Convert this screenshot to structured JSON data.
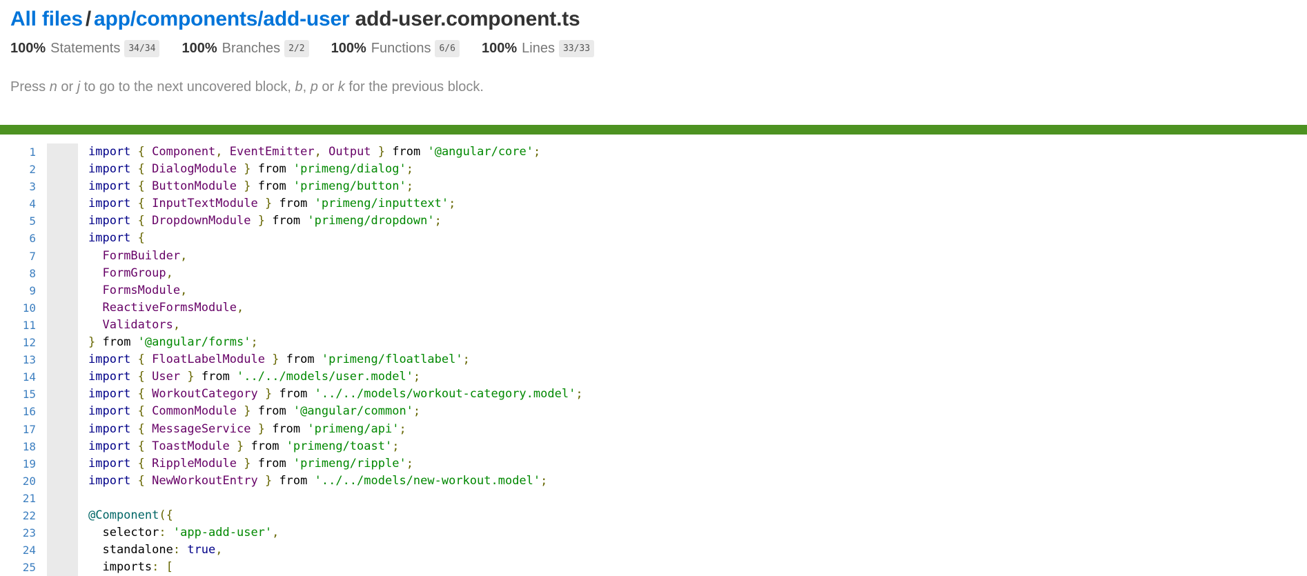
{
  "breadcrumb": {
    "root": "All files",
    "separator": "/",
    "dir": "app/components/add-user",
    "file": "add-user.component.ts"
  },
  "summary": [
    {
      "pct": "100%",
      "name": "Statements",
      "fraction": "34/34"
    },
    {
      "pct": "100%",
      "name": "Branches",
      "fraction": "2/2"
    },
    {
      "pct": "100%",
      "name": "Functions",
      "fraction": "6/6"
    },
    {
      "pct": "100%",
      "name": "Lines",
      "fraction": "33/33"
    }
  ],
  "hint": {
    "prefix": "Press ",
    "k1": "n",
    "or1": " or ",
    "k2": "j",
    "mid": " to go to the next uncovered block, ",
    "k3": "b",
    "comma": ", ",
    "k4": "p",
    "or2": " or ",
    "k5": "k",
    "suffix": " for the previous block."
  },
  "colors": {
    "link": "#0074d9",
    "status_bar": "#4d9221",
    "gutter": "#eaeaea"
  },
  "code": [
    {
      "n": "1",
      "t": [
        [
          "kw",
          "import"
        ],
        [
          "pln",
          " "
        ],
        [
          "pun",
          "{"
        ],
        [
          "pln",
          " "
        ],
        [
          "typ",
          "Component"
        ],
        [
          "pun",
          ","
        ],
        [
          "pln",
          " "
        ],
        [
          "typ",
          "EventEmitter"
        ],
        [
          "pun",
          ","
        ],
        [
          "pln",
          " "
        ],
        [
          "typ",
          "Output"
        ],
        [
          "pln",
          " "
        ],
        [
          "pun",
          "}"
        ],
        [
          "pln",
          " from "
        ],
        [
          "str",
          "'@angular/core'"
        ],
        [
          "pun",
          ";"
        ]
      ]
    },
    {
      "n": "2",
      "t": [
        [
          "kw",
          "import"
        ],
        [
          "pln",
          " "
        ],
        [
          "pun",
          "{"
        ],
        [
          "pln",
          " "
        ],
        [
          "typ",
          "DialogModule"
        ],
        [
          "pln",
          " "
        ],
        [
          "pun",
          "}"
        ],
        [
          "pln",
          " from "
        ],
        [
          "str",
          "'primeng/dialog'"
        ],
        [
          "pun",
          ";"
        ]
      ]
    },
    {
      "n": "3",
      "t": [
        [
          "kw",
          "import"
        ],
        [
          "pln",
          " "
        ],
        [
          "pun",
          "{"
        ],
        [
          "pln",
          " "
        ],
        [
          "typ",
          "ButtonModule"
        ],
        [
          "pln",
          " "
        ],
        [
          "pun",
          "}"
        ],
        [
          "pln",
          " from "
        ],
        [
          "str",
          "'primeng/button'"
        ],
        [
          "pun",
          ";"
        ]
      ]
    },
    {
      "n": "4",
      "t": [
        [
          "kw",
          "import"
        ],
        [
          "pln",
          " "
        ],
        [
          "pun",
          "{"
        ],
        [
          "pln",
          " "
        ],
        [
          "typ",
          "InputTextModule"
        ],
        [
          "pln",
          " "
        ],
        [
          "pun",
          "}"
        ],
        [
          "pln",
          " from "
        ],
        [
          "str",
          "'primeng/inputtext'"
        ],
        [
          "pun",
          ";"
        ]
      ]
    },
    {
      "n": "5",
      "t": [
        [
          "kw",
          "import"
        ],
        [
          "pln",
          " "
        ],
        [
          "pun",
          "{"
        ],
        [
          "pln",
          " "
        ],
        [
          "typ",
          "DropdownModule"
        ],
        [
          "pln",
          " "
        ],
        [
          "pun",
          "}"
        ],
        [
          "pln",
          " from "
        ],
        [
          "str",
          "'primeng/dropdown'"
        ],
        [
          "pun",
          ";"
        ]
      ]
    },
    {
      "n": "6",
      "t": [
        [
          "kw",
          "import"
        ],
        [
          "pln",
          " "
        ],
        [
          "pun",
          "{"
        ]
      ]
    },
    {
      "n": "7",
      "t": [
        [
          "pln",
          "  "
        ],
        [
          "typ",
          "FormBuilder"
        ],
        [
          "pun",
          ","
        ]
      ]
    },
    {
      "n": "8",
      "t": [
        [
          "pln",
          "  "
        ],
        [
          "typ",
          "FormGroup"
        ],
        [
          "pun",
          ","
        ]
      ]
    },
    {
      "n": "9",
      "t": [
        [
          "pln",
          "  "
        ],
        [
          "typ",
          "FormsModule"
        ],
        [
          "pun",
          ","
        ]
      ]
    },
    {
      "n": "10",
      "t": [
        [
          "pln",
          "  "
        ],
        [
          "typ",
          "ReactiveFormsModule"
        ],
        [
          "pun",
          ","
        ]
      ]
    },
    {
      "n": "11",
      "t": [
        [
          "pln",
          "  "
        ],
        [
          "typ",
          "Validators"
        ],
        [
          "pun",
          ","
        ]
      ]
    },
    {
      "n": "12",
      "t": [
        [
          "pun",
          "}"
        ],
        [
          "pln",
          " from "
        ],
        [
          "str",
          "'@angular/forms'"
        ],
        [
          "pun",
          ";"
        ]
      ]
    },
    {
      "n": "13",
      "t": [
        [
          "kw",
          "import"
        ],
        [
          "pln",
          " "
        ],
        [
          "pun",
          "{"
        ],
        [
          "pln",
          " "
        ],
        [
          "typ",
          "FloatLabelModule"
        ],
        [
          "pln",
          " "
        ],
        [
          "pun",
          "}"
        ],
        [
          "pln",
          " from "
        ],
        [
          "str",
          "'primeng/floatlabel'"
        ],
        [
          "pun",
          ";"
        ]
      ]
    },
    {
      "n": "14",
      "t": [
        [
          "kw",
          "import"
        ],
        [
          "pln",
          " "
        ],
        [
          "pun",
          "{"
        ],
        [
          "pln",
          " "
        ],
        [
          "typ",
          "User"
        ],
        [
          "pln",
          " "
        ],
        [
          "pun",
          "}"
        ],
        [
          "pln",
          " from "
        ],
        [
          "str",
          "'../../models/user.model'"
        ],
        [
          "pun",
          ";"
        ]
      ]
    },
    {
      "n": "15",
      "t": [
        [
          "kw",
          "import"
        ],
        [
          "pln",
          " "
        ],
        [
          "pun",
          "{"
        ],
        [
          "pln",
          " "
        ],
        [
          "typ",
          "WorkoutCategory"
        ],
        [
          "pln",
          " "
        ],
        [
          "pun",
          "}"
        ],
        [
          "pln",
          " from "
        ],
        [
          "str",
          "'../../models/workout-category.model'"
        ],
        [
          "pun",
          ";"
        ]
      ]
    },
    {
      "n": "16",
      "t": [
        [
          "kw",
          "import"
        ],
        [
          "pln",
          " "
        ],
        [
          "pun",
          "{"
        ],
        [
          "pln",
          " "
        ],
        [
          "typ",
          "CommonModule"
        ],
        [
          "pln",
          " "
        ],
        [
          "pun",
          "}"
        ],
        [
          "pln",
          " from "
        ],
        [
          "str",
          "'@angular/common'"
        ],
        [
          "pun",
          ";"
        ]
      ]
    },
    {
      "n": "17",
      "t": [
        [
          "kw",
          "import"
        ],
        [
          "pln",
          " "
        ],
        [
          "pun",
          "{"
        ],
        [
          "pln",
          " "
        ],
        [
          "typ",
          "MessageService"
        ],
        [
          "pln",
          " "
        ],
        [
          "pun",
          "}"
        ],
        [
          "pln",
          " from "
        ],
        [
          "str",
          "'primeng/api'"
        ],
        [
          "pun",
          ";"
        ]
      ]
    },
    {
      "n": "18",
      "t": [
        [
          "kw",
          "import"
        ],
        [
          "pln",
          " "
        ],
        [
          "pun",
          "{"
        ],
        [
          "pln",
          " "
        ],
        [
          "typ",
          "ToastModule"
        ],
        [
          "pln",
          " "
        ],
        [
          "pun",
          "}"
        ],
        [
          "pln",
          " from "
        ],
        [
          "str",
          "'primeng/toast'"
        ],
        [
          "pun",
          ";"
        ]
      ]
    },
    {
      "n": "19",
      "t": [
        [
          "kw",
          "import"
        ],
        [
          "pln",
          " "
        ],
        [
          "pun",
          "{"
        ],
        [
          "pln",
          " "
        ],
        [
          "typ",
          "RippleModule"
        ],
        [
          "pln",
          " "
        ],
        [
          "pun",
          "}"
        ],
        [
          "pln",
          " from "
        ],
        [
          "str",
          "'primeng/ripple'"
        ],
        [
          "pun",
          ";"
        ]
      ]
    },
    {
      "n": "20",
      "t": [
        [
          "kw",
          "import"
        ],
        [
          "pln",
          " "
        ],
        [
          "pun",
          "{"
        ],
        [
          "pln",
          " "
        ],
        [
          "typ",
          "NewWorkoutEntry"
        ],
        [
          "pln",
          " "
        ],
        [
          "pun",
          "}"
        ],
        [
          "pln",
          " from "
        ],
        [
          "str",
          "'../../models/new-workout.model'"
        ],
        [
          "pun",
          ";"
        ]
      ]
    },
    {
      "n": "21",
      "t": []
    },
    {
      "n": "22",
      "t": [
        [
          "dec",
          "@Component"
        ],
        [
          "pun",
          "({"
        ]
      ]
    },
    {
      "n": "23",
      "t": [
        [
          "pln",
          "  selector"
        ],
        [
          "pun",
          ":"
        ],
        [
          "pln",
          " "
        ],
        [
          "str",
          "'app-add-user'"
        ],
        [
          "pun",
          ","
        ]
      ]
    },
    {
      "n": "24",
      "t": [
        [
          "pln",
          "  standalone"
        ],
        [
          "pun",
          ":"
        ],
        [
          "pln",
          " "
        ],
        [
          "kw",
          "true"
        ],
        [
          "pun",
          ","
        ]
      ]
    },
    {
      "n": "25",
      "t": [
        [
          "pln",
          "  imports"
        ],
        [
          "pun",
          ":"
        ],
        [
          "pln",
          " "
        ],
        [
          "pun",
          "["
        ]
      ]
    }
  ]
}
